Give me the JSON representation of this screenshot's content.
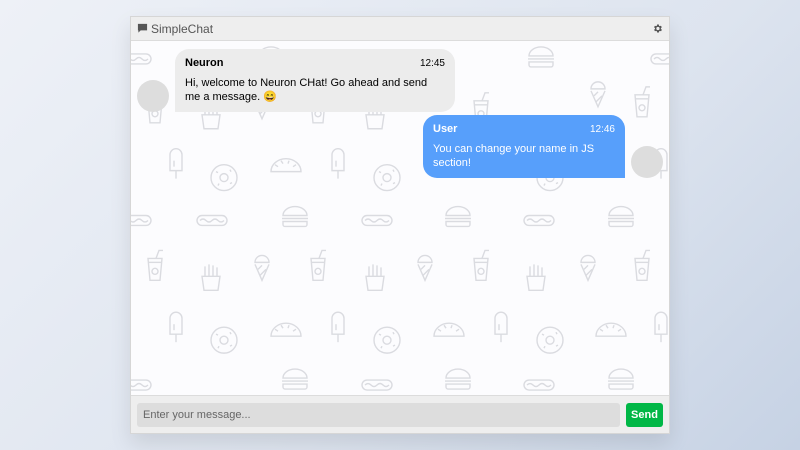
{
  "app": {
    "title": "SimpleChat",
    "header_icon": "chat-bubble-icon",
    "settings_icon": "gear-icon"
  },
  "colors": {
    "sent_bubble": "#579ffb",
    "received_bubble": "#ececec",
    "send_button": "#00b746",
    "header_bg": "#eeeeee"
  },
  "messages": [
    {
      "sender": "Neuron",
      "time": "12:45",
      "text": "Hi, welcome to Neuron CHat! Go ahead and send me a message. 😄",
      "side": "left"
    },
    {
      "sender": "User",
      "time": "12:46",
      "text": "You can change your name in JS section!",
      "side": "right"
    }
  ],
  "input": {
    "placeholder": "Enter your message...",
    "value": ""
  },
  "send_button": {
    "label": "Send"
  }
}
